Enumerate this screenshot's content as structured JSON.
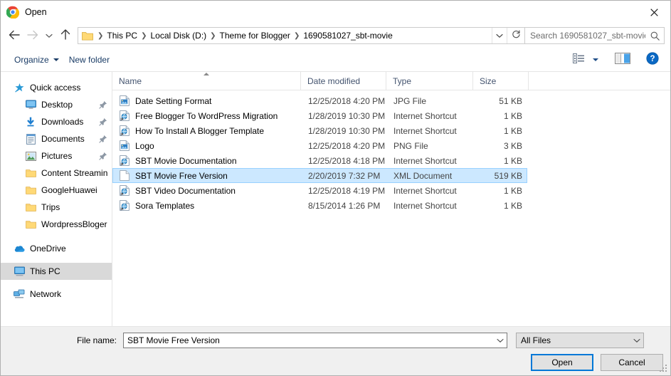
{
  "window": {
    "title": "Open",
    "app_icon": "chrome-icon",
    "close_label": "Close"
  },
  "nav": {
    "back_icon": "back-arrow-icon",
    "forward_icon": "forward-arrow-icon",
    "recent_icon": "chevron-down-icon",
    "up_icon": "up-arrow-icon",
    "folder_icon": "folder-icon",
    "breadcrumbs": [
      {
        "label": "This PC"
      },
      {
        "label": "Local Disk (D:)"
      },
      {
        "label": "Theme for Blogger"
      },
      {
        "label": "1690581027_sbt-movie"
      }
    ],
    "dropdown_icon": "chevron-down-icon",
    "refresh_icon": "refresh-icon"
  },
  "search": {
    "placeholder": "Search 1690581027_sbt-movie",
    "icon": "search-icon"
  },
  "toolbar": {
    "organize_label": "Organize",
    "organize_caret": "caret-down-icon",
    "new_folder_label": "New folder",
    "view_icon": "view-options-icon",
    "view_caret": "caret-down-icon",
    "preview_pane_icon": "preview-pane-icon",
    "help_icon": "help-icon"
  },
  "sidebar": {
    "items": [
      {
        "label": "Quick access",
        "icon": "quick-access-star-icon",
        "level": 0,
        "pinned": false,
        "selected": false
      },
      {
        "label": "Desktop",
        "icon": "desktop-icon",
        "level": 1,
        "pinned": true,
        "selected": false
      },
      {
        "label": "Downloads",
        "icon": "downloads-icon",
        "level": 1,
        "pinned": true,
        "selected": false
      },
      {
        "label": "Documents",
        "icon": "documents-icon",
        "level": 1,
        "pinned": true,
        "selected": false
      },
      {
        "label": "Pictures",
        "icon": "pictures-icon",
        "level": 1,
        "pinned": true,
        "selected": false
      },
      {
        "label": "Content Streaming",
        "icon": "folder-icon",
        "level": 1,
        "pinned": false,
        "selected": false
      },
      {
        "label": "GoogleHuawei",
        "icon": "folder-icon",
        "level": 1,
        "pinned": false,
        "selected": false
      },
      {
        "label": "Trips",
        "icon": "folder-icon",
        "level": 1,
        "pinned": false,
        "selected": false
      },
      {
        "label": "WordpressBloger Th",
        "icon": "folder-icon",
        "level": 1,
        "pinned": false,
        "selected": false
      },
      {
        "label": "OneDrive",
        "icon": "onedrive-cloud-icon",
        "level": 0,
        "pinned": false,
        "selected": false
      },
      {
        "label": "This PC",
        "icon": "this-pc-icon",
        "level": 0,
        "pinned": false,
        "selected": true
      },
      {
        "label": "Network",
        "icon": "network-icon",
        "level": 0,
        "pinned": false,
        "selected": false
      }
    ]
  },
  "file_list": {
    "columns": [
      {
        "label": "Name",
        "sorted": true,
        "sort_direction": "ascending"
      },
      {
        "label": "Date modified",
        "sorted": false
      },
      {
        "label": "Type",
        "sorted": false
      },
      {
        "label": "Size",
        "sorted": false
      }
    ],
    "rows": [
      {
        "name": "Date Setting Format",
        "date": "12/25/2018 4:20 PM",
        "type": "JPG File",
        "size": "51 KB",
        "icon": "image-file-icon",
        "selected": false
      },
      {
        "name": "Free Blogger To WordPress Migration",
        "date": "1/28/2019 10:30 PM",
        "type": "Internet Shortcut",
        "size": "1 KB",
        "icon": "internet-shortcut-icon",
        "selected": false
      },
      {
        "name": "How To Install A Blogger Template",
        "date": "1/28/2019 10:30 PM",
        "type": "Internet Shortcut",
        "size": "1 KB",
        "icon": "internet-shortcut-icon",
        "selected": false
      },
      {
        "name": "Logo",
        "date": "12/25/2018 4:20 PM",
        "type": "PNG File",
        "size": "3 KB",
        "icon": "image-file-icon",
        "selected": false
      },
      {
        "name": "SBT Movie Documentation",
        "date": "12/25/2018 4:18 PM",
        "type": "Internet Shortcut",
        "size": "1 KB",
        "icon": "internet-shortcut-icon",
        "selected": false
      },
      {
        "name": "SBT Movie Free Version",
        "date": "2/20/2019 7:32 PM",
        "type": "XML Document",
        "size": "519 KB",
        "icon": "document-file-icon",
        "selected": true
      },
      {
        "name": "SBT Video Documentation",
        "date": "12/25/2018 4:19 PM",
        "type": "Internet Shortcut",
        "size": "1 KB",
        "icon": "internet-shortcut-icon",
        "selected": false
      },
      {
        "name": "Sora Templates",
        "date": "8/15/2014 1:26 PM",
        "type": "Internet Shortcut",
        "size": "1 KB",
        "icon": "internet-shortcut-icon",
        "selected": false
      }
    ]
  },
  "footer": {
    "file_name_label": "File name:",
    "file_name_value": "SBT Movie Free Version",
    "file_name_dropdown_icon": "chevron-down-icon",
    "filter_value": "All Files",
    "filter_dropdown_icon": "chevron-down-icon",
    "open_label": "Open",
    "cancel_label": "Cancel",
    "resize_grip": "resize-grip-icon"
  },
  "colors": {
    "selection_fill": "#cce8ff",
    "selection_border": "#99d1ff",
    "sidebar_selection": "#d9d9d9",
    "accent": "#0078d7",
    "header_text": "#44546f",
    "footer_bg": "#f0f0f0"
  }
}
